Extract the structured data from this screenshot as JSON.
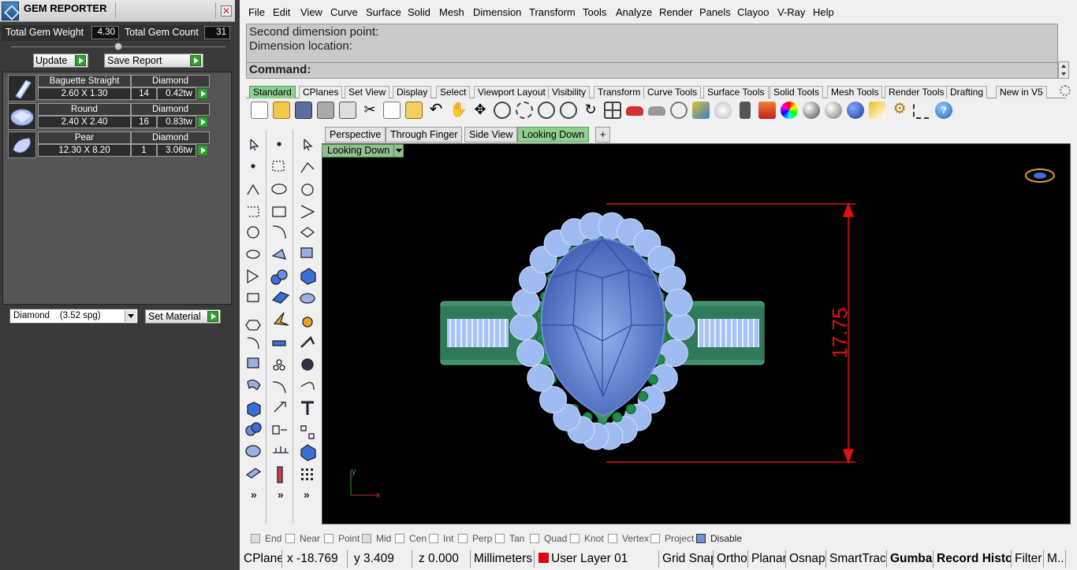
{
  "gem_panel": {
    "title": "GEM REPORTER",
    "total_weight_label": "Total Gem Weight",
    "total_weight_value": "4.30",
    "total_count_label": "Total Gem Count",
    "total_count_value": "31",
    "update_label": "Update",
    "save_report_label": "Save Report",
    "gems": [
      {
        "shape": "Baguette Straight",
        "material": "Diamond",
        "size": "2.60 X 1.30",
        "count": "14",
        "weight": "0.42tw"
      },
      {
        "shape": "Round",
        "material": "Diamond",
        "size": "2.40 X 2.40",
        "count": "16",
        "weight": "0.83tw"
      },
      {
        "shape": "Pear",
        "material": "Diamond",
        "size": "12.30 X 8.20",
        "count": "1",
        "weight": "3.06tw"
      }
    ],
    "material_select": "Diamond    (3.52 spg)",
    "set_material_label": "Set Material"
  },
  "menu": [
    "File",
    "Edit",
    "View",
    "Curve",
    "Surface",
    "Solid",
    "Mesh",
    "Dimension",
    "Transform",
    "Tools",
    "Analyze",
    "Render",
    "Panels",
    "Clayoo",
    "V-Ray",
    "Help"
  ],
  "command": {
    "line1": "Second dimension point:",
    "line2": "Dimension location:",
    "prompt": "Command:"
  },
  "toolbar_tabs": [
    "Standard",
    "CPlanes",
    "Set View",
    "Display",
    "Select",
    "Viewport Layout",
    "Visibility",
    "Transform",
    "Curve Tools",
    "Surface Tools",
    "Solid Tools",
    "Mesh Tools",
    "Render Tools",
    "Drafting",
    "New in V5"
  ],
  "viewport_tabs": [
    "Perspective",
    "Through Finger",
    "Side View",
    "Looking Down",
    "+"
  ],
  "viewport": {
    "name": "Looking Down",
    "dimension_value": "17.75",
    "axis_x": "x",
    "axis_y": "y"
  },
  "osnaps": [
    {
      "label": "End",
      "checked": true
    },
    {
      "label": "Near",
      "checked": false
    },
    {
      "label": "Point",
      "checked": false
    },
    {
      "label": "Mid",
      "checked": true
    },
    {
      "label": "Cen",
      "checked": false
    },
    {
      "label": "Int",
      "checked": false
    },
    {
      "label": "Perp",
      "checked": false
    },
    {
      "label": "Tan",
      "checked": false
    },
    {
      "label": "Quad",
      "checked": false
    },
    {
      "label": "Knot",
      "checked": false
    },
    {
      "label": "Vertex",
      "checked": false
    },
    {
      "label": "Project",
      "checked": false
    },
    {
      "label": "Disable",
      "checked": false
    }
  ],
  "status": {
    "cplane": "CPlane",
    "x": "x -18.769",
    "y": "y 3.409",
    "z": "z 0.000",
    "units": "Millimeters",
    "layer": "User Layer 01",
    "layer_color": "#e0001a",
    "grid_snap": "Grid Snap",
    "ortho": "Ortho",
    "planar": "Planar",
    "osnap": "Osnap",
    "smarttrack": "SmartTrack",
    "gumball": "Gumball",
    "record_history": "Record History",
    "filter": "Filter",
    "more": "M..."
  },
  "colors": {
    "tab_active": "#8fd08f",
    "dimension": "#e01010",
    "gem_blue": "#6f8fd8",
    "ring_green": "#3f8f6a"
  }
}
